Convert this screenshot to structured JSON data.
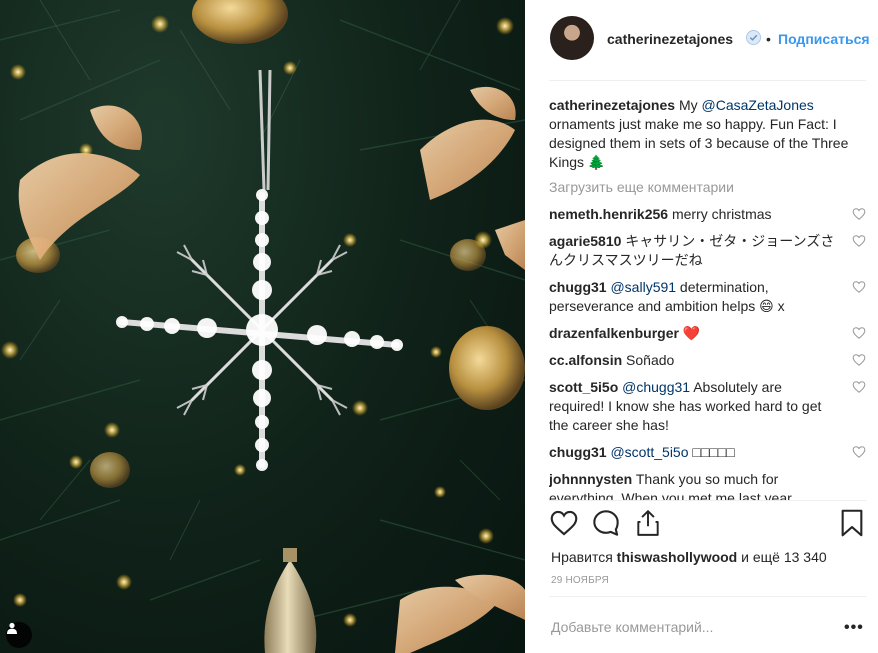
{
  "header": {
    "username": "catherinezetajones",
    "separator": "•",
    "follow_label": "Подписаться"
  },
  "caption": {
    "username": "catherinezetajones",
    "text_prefix": "My ",
    "mention": "@CasaZetaJones",
    "text_suffix": " ornaments just make me so happy. Fun Fact: I designed them in sets of 3 because of the Three Kings 🌲"
  },
  "load_more_label": "Загрузить еще комментарии",
  "comments": [
    {
      "username": "nemeth.henrik256",
      "text": "merry christmas"
    },
    {
      "username": "agarie5810",
      "text": "キャサリン・ゼタ・ジョーンズさんクリスマスツリーだね"
    },
    {
      "username": "chugg31",
      "mention": "@sally591",
      "text": " determination, perseverance and ambition helps 😄 x"
    },
    {
      "username": "drazenfalkenburger",
      "text": "❤️"
    },
    {
      "username": "cc.alfonsin",
      "text": "Soñado"
    },
    {
      "username": "scott_5i5o",
      "mention": "@chugg31",
      "text": " Absolutely are required! I know she has worked hard to get the career she has!"
    },
    {
      "username": "chugg31",
      "mention": "@scott_5i5o",
      "text": " □□□□□"
    },
    {
      "username": "johnnnysten",
      "text": "Thank you so much for everything. When you met me last year,"
    }
  ],
  "likes": {
    "prefix": "Нравится ",
    "user": "thiswashollywood",
    "suffix": " и ещё 13 340"
  },
  "date": "29 НОЯБРЯ",
  "add_comment_placeholder": "Добавьте комментарий...",
  "more_label": "•••",
  "icons": {
    "like": "heart-icon",
    "comment": "comment-icon",
    "share": "share-icon",
    "save": "bookmark-icon",
    "tag": "user-tag-icon",
    "verified": "verified-badge-icon"
  },
  "colors": {
    "link": "#3897f0",
    "mention": "#003569",
    "muted": "#999999",
    "text": "#262626"
  }
}
